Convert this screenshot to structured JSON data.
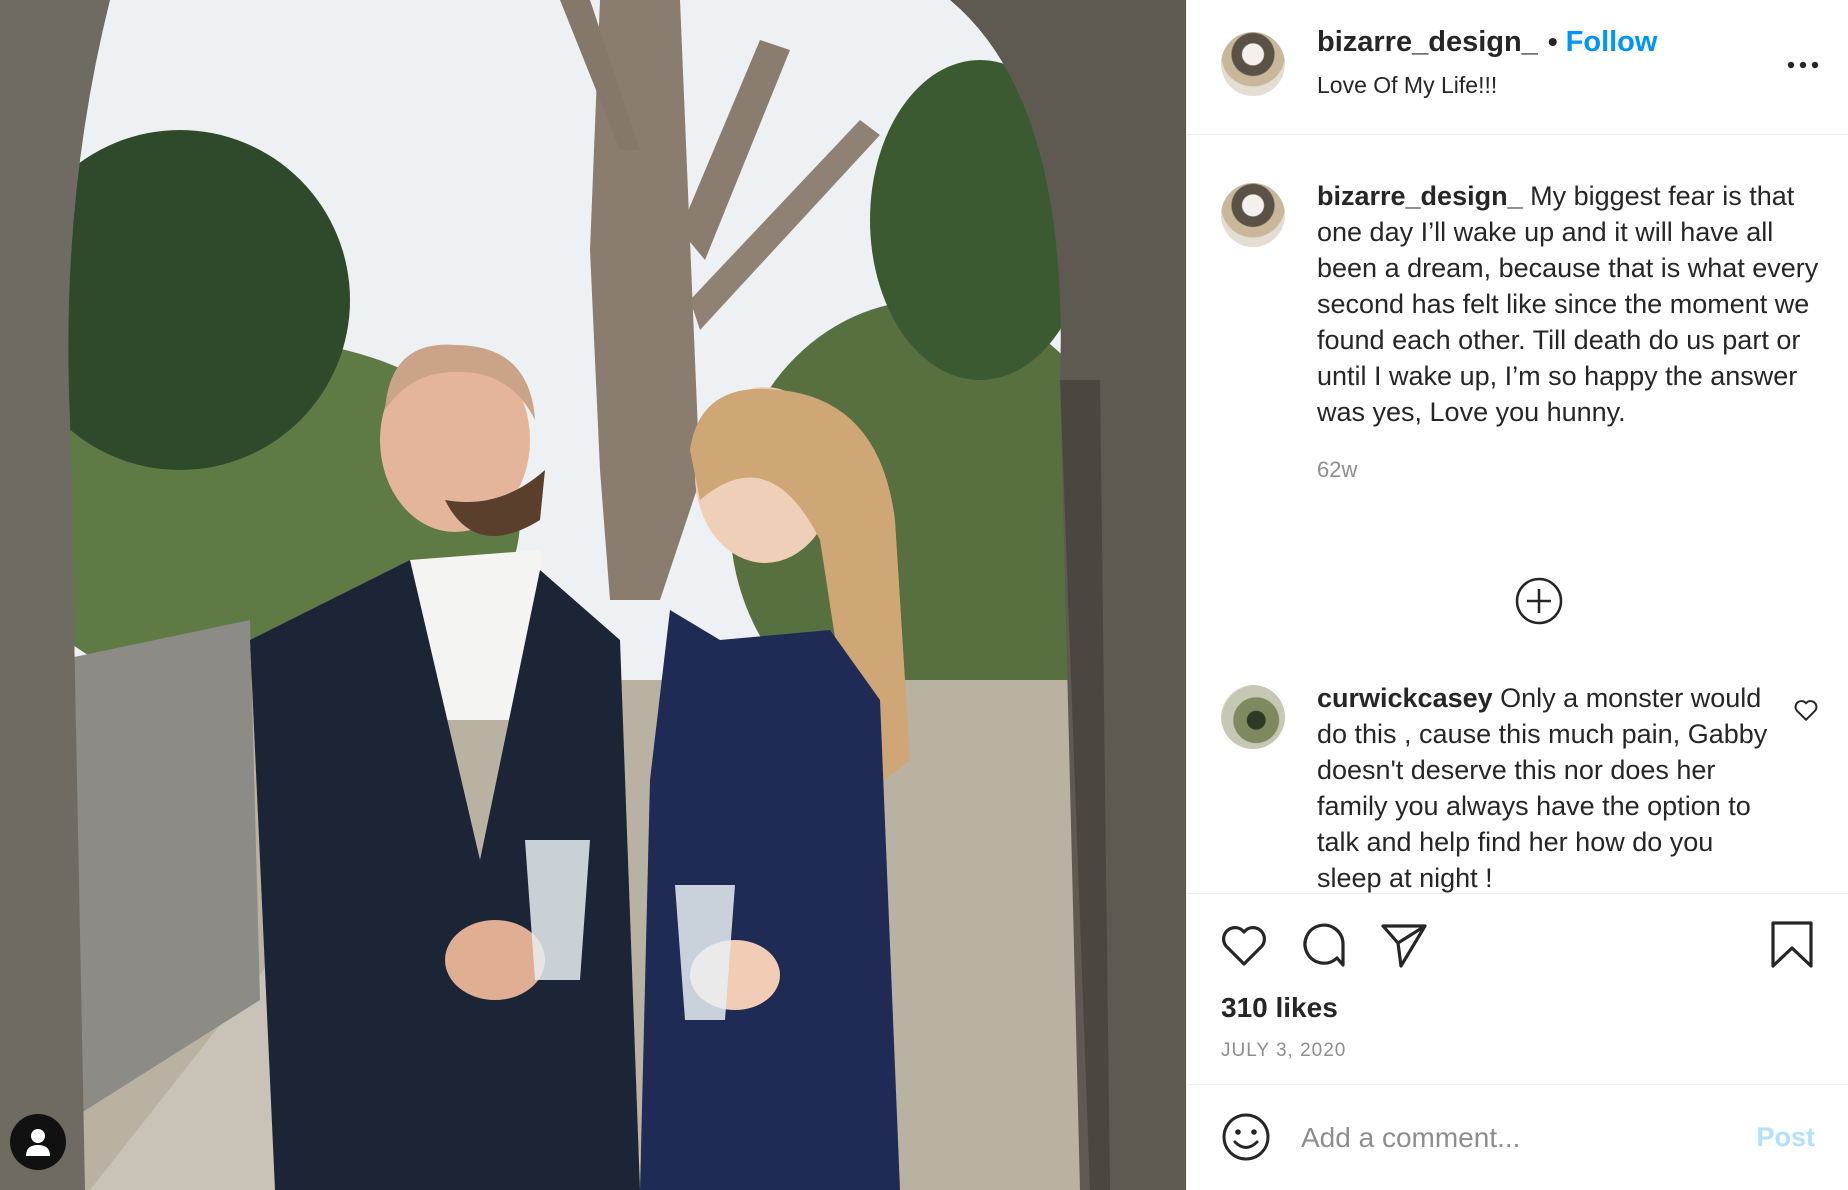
{
  "post": {
    "username": "bizarre_design_",
    "follow_label": "Follow",
    "separator": "•",
    "location": "Love Of My Life!!!",
    "more_label": "•••"
  },
  "caption": {
    "username": "bizarre_design_",
    "text": "My biggest fear is that one day I’ll wake up and it will have all been a dream, because that is what every second has felt like since the moment we found each other. Till death do us part or until I wake up, I’m so happy the answer was yes, Love you hunny.",
    "time": "62w"
  },
  "comments": [
    {
      "username": "curwickcasey",
      "text": "Only a monster would do this , cause this much pain, Gabby doesn't deserve this nor does her family you always have the option to talk and help find her how do you sleep at night !"
    }
  ],
  "stats": {
    "likes": "310 likes",
    "date": "JULY 3, 2020"
  },
  "composer": {
    "placeholder": "Add a comment...",
    "post_label": "Post"
  },
  "icons": [
    "user-icon",
    "more-icon",
    "plus-circle-icon",
    "heart-icon",
    "comment-icon",
    "share-icon",
    "bookmark-icon",
    "smile-icon"
  ],
  "colors": {
    "accent": "#0095f6",
    "post_disabled": "#b2dffc",
    "muted": "#8e8e8e",
    "text": "#262626"
  }
}
